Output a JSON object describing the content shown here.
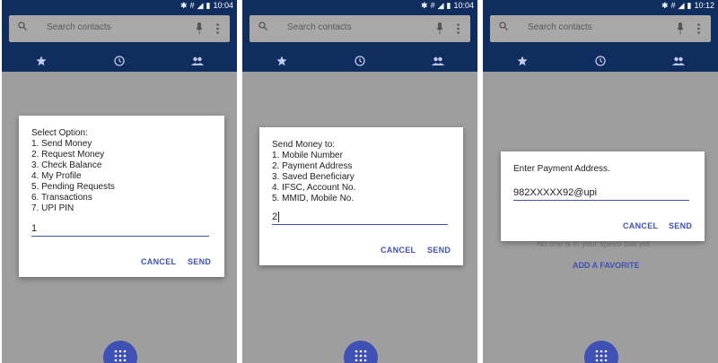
{
  "screens": [
    {
      "status_time": "10:04",
      "search_placeholder": "Search contacts",
      "dialog": {
        "title": "Select Option:",
        "options": [
          "1. Send Money",
          "2. Request Money",
          "3. Check Balance",
          "4. My Profile",
          "5. Pending Requests",
          "6. Transactions",
          "7. UPI PIN"
        ],
        "input_value": "1",
        "cancel_label": "CANCEL",
        "send_label": "SEND"
      }
    },
    {
      "status_time": "10:04",
      "search_placeholder": "Search contacts",
      "dialog": {
        "title": "Send Money to:",
        "options": [
          "1. Mobile Number",
          "2. Payment Address",
          "3. Saved Beneficiary",
          "4. IFSC, Account No.",
          "5. MMID, Mobile No."
        ],
        "input_value": "2",
        "cancel_label": "CANCEL",
        "send_label": "SEND"
      }
    },
    {
      "status_time": "10:12",
      "search_placeholder": "Search contacts",
      "dialog": {
        "title": "Enter Payment Address.",
        "input_value": "982XXXXX92@upi",
        "cancel_label": "CANCEL",
        "send_label": "SEND"
      },
      "background_hint": "No one is in your speed dial yet",
      "background_link": "ADD A FAVORITE"
    }
  ],
  "colors": {
    "appbar": "#0f2d5e",
    "accent": "#3f51b5",
    "backdrop": "#9e9e9e"
  },
  "icons": [
    "search-icon",
    "mic-icon",
    "more-vert-icon",
    "star-icon",
    "clock-icon",
    "people-icon",
    "dialpad-icon",
    "bluetooth-icon",
    "wifi-icon",
    "signal-icon",
    "battery-icon"
  ]
}
